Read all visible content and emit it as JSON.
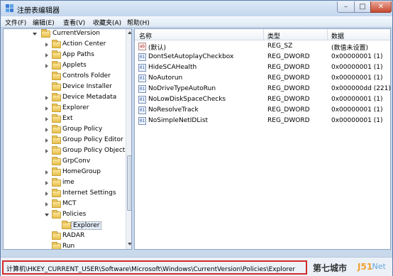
{
  "window": {
    "title": "注册表编辑器"
  },
  "menu": [
    "文件(F)",
    "编辑(E)",
    "查看(V)",
    "收藏夹(A)",
    "帮助(H)"
  ],
  "tree": {
    "current_version": "CurrentVersion",
    "items": [
      "Action Center",
      "App Paths",
      "Applets",
      "Controls Folder",
      "Device Installer",
      "Device Metadata",
      "Explorer",
      "Ext",
      "Group Policy",
      "Group Policy Editor",
      "Group Policy Objects",
      "GrpConv",
      "HomeGroup",
      "ime",
      "Internet Settings",
      "MCT"
    ],
    "policies": "Policies",
    "explorer_selected": "Explorer",
    "after": [
      "RADAR",
      "Run"
    ]
  },
  "list": {
    "headers": {
      "name": "名称",
      "type": "类型",
      "data": "数据"
    },
    "rows": [
      {
        "name": "(默认)",
        "type": "REG_SZ",
        "data": "(数值未设置)",
        "icon": "string-value-icon"
      },
      {
        "name": "DontSetAutoplayCheckbox",
        "type": "REG_DWORD",
        "data": "0x00000001 (1)",
        "icon": "dword-value-icon"
      },
      {
        "name": "HideSCAHealth",
        "type": "REG_DWORD",
        "data": "0x00000001 (1)",
        "icon": "dword-value-icon"
      },
      {
        "name": "NoAutorun",
        "type": "REG_DWORD",
        "data": "0x00000001 (1)",
        "icon": "dword-value-icon"
      },
      {
        "name": "NoDriveTypeAutoRun",
        "type": "REG_DWORD",
        "data": "0x000000dd (221)",
        "icon": "dword-value-icon"
      },
      {
        "name": "NoLowDiskSpaceChecks",
        "type": "REG_DWORD",
        "data": "0x00000001 (1)",
        "icon": "dword-value-icon"
      },
      {
        "name": "NoResolveTrack",
        "type": "REG_DWORD",
        "data": "0x00000001 (1)",
        "icon": "dword-value-icon"
      },
      {
        "name": "NoSimpleNetIDList",
        "type": "REG_DWORD",
        "data": "0x00000001 (1)",
        "icon": "dword-value-icon"
      }
    ]
  },
  "status": {
    "path": "计算机\\HKEY_CURRENT_USER\\Software\\Microsoft\\Windows\\CurrentVersion\\Policies\\Explorer"
  },
  "watermark": {
    "part1": "第七城市",
    "part2": "J51",
    "part3": ".Net"
  },
  "colors": {
    "status_highlight": "#d22a2a",
    "window_frame": "#c9d9ec"
  }
}
